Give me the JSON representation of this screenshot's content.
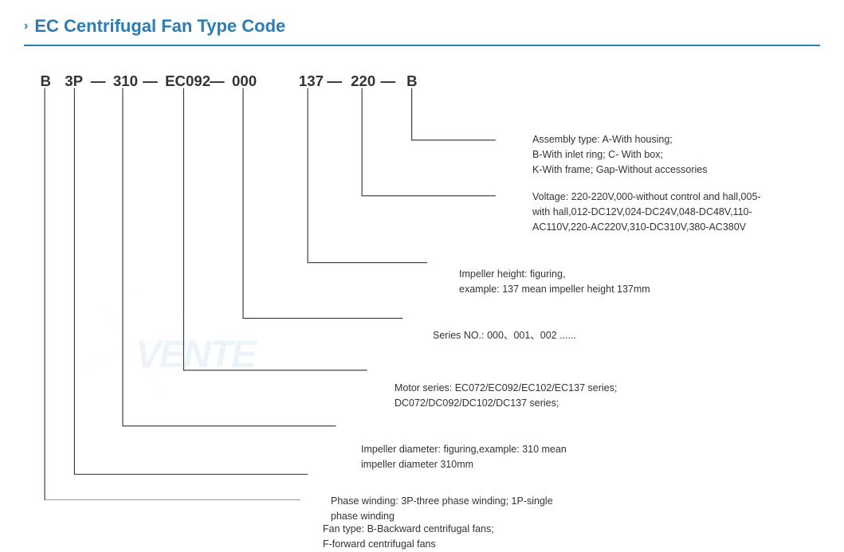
{
  "title": "EC Centrifugal Fan Type Code",
  "chevron": "›",
  "type_code": {
    "parts": [
      "B",
      "3P",
      "310",
      "EC092",
      "000",
      "137",
      "220",
      "B"
    ],
    "dashes": [
      "—",
      "—",
      "—",
      "—",
      "—",
      "—"
    ]
  },
  "descriptions": {
    "assembly": {
      "label": "Assembly type:",
      "text": " A-With housing;\nB-With inlet ring;  C- With box;\nK-With frame; Gap-Without accessories"
    },
    "voltage": {
      "label": "Voltage:",
      "text": " 220-220V,000-without control and hall,005-with hall,012-DC12V,024-DC24V,048-DC48V,110-AC110V,220-AC220V,310-DC310V,380-AC380V"
    },
    "impeller_height": {
      "label": "Impeller height:",
      "text": "  figuring,\nexample: 137 mean impeller height 137mm"
    },
    "series_no": {
      "label": "Series NO.:",
      "text": " 000、001、002 ......"
    },
    "motor_series": {
      "label": "Motor series:",
      "text": " EC072/EC092/EC102/EC137 series;\nDC072/DC092/DC102/DC137 series;"
    },
    "impeller_diameter": {
      "label": "Impeller diameter:",
      "text": " figuring,example: 310 mean\nimpeller diameter 310mm"
    },
    "phase_winding": {
      "label": "Phase winding:",
      "text": " 3P-three phase winding;  1P-single\nphase winding"
    },
    "fan_type": {
      "label": "Fan type:",
      "text": " B-Backward centrifugal fans;\nF-forward centrifugal fans"
    }
  },
  "watermark_text": "VENTE",
  "colors": {
    "primary": "#2a7db5",
    "text": "#333333",
    "line": "#333333"
  }
}
